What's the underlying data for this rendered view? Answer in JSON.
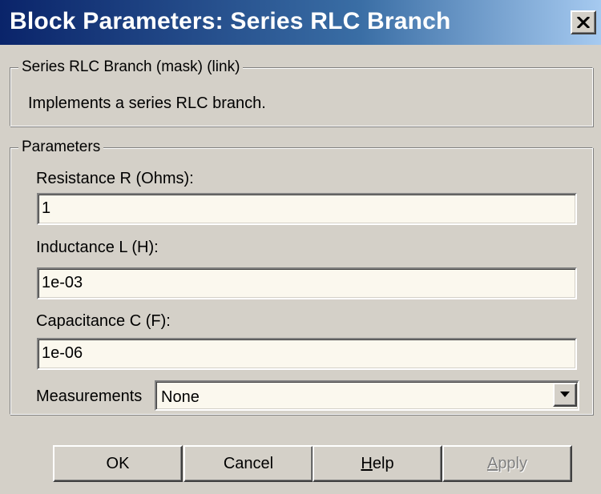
{
  "window": {
    "title": "Block Parameters: Series RLC Branch",
    "close_icon": "close-icon",
    "colors": {
      "titlebar_start": "#0a246a",
      "titlebar_end": "#a6caf0",
      "face": "#d4d0c8",
      "field_bg": "#fbf8ee"
    }
  },
  "description_group": {
    "legend": "Series RLC Branch (mask) (link)",
    "text": "Implements a series RLC branch."
  },
  "parameters_group": {
    "legend": "Parameters",
    "resistance": {
      "label": "Resistance R (Ohms):",
      "value": "1"
    },
    "inductance": {
      "label": "Inductance L (H):",
      "value": "1e-03"
    },
    "capacitance": {
      "label": "Capacitance C (F):",
      "value": "1e-06"
    },
    "measurements": {
      "label": "Measurements",
      "selected": "None",
      "arrow_icon": "chevron-down-icon"
    }
  },
  "buttons": {
    "ok": "OK",
    "cancel": "Cancel",
    "help_mnemonic": "H",
    "help_rest": "elp",
    "apply_mnemonic": "A",
    "apply_rest": "pply",
    "apply_enabled": false
  }
}
